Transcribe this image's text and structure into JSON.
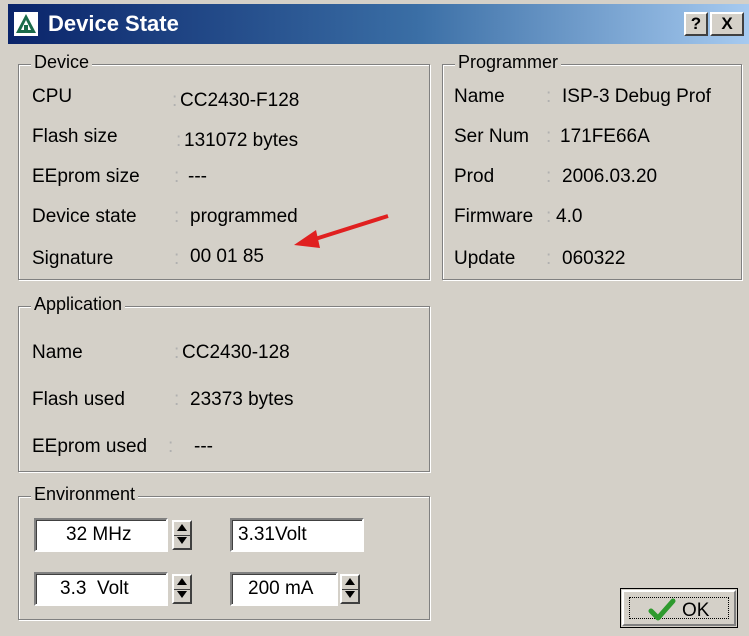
{
  "window": {
    "title": "Device State",
    "help_label": "?",
    "close_label": "X"
  },
  "device": {
    "legend": "Device",
    "rows": [
      {
        "label": "CPU",
        "value": "CC2430-F128"
      },
      {
        "label": "Flash size",
        "value": "131072 bytes"
      },
      {
        "label": "EEprom size",
        "value": "---"
      },
      {
        "label": "Device state",
        "value": "programmed"
      },
      {
        "label": "Signature",
        "value": "00 01 85"
      }
    ]
  },
  "programmer": {
    "legend": "Programmer",
    "rows": [
      {
        "label": "Name",
        "value": "ISP-3 Debug Prof"
      },
      {
        "label": "Ser Num",
        "value": "171FE66A"
      },
      {
        "label": "Prod",
        "value": "2006.03.20"
      },
      {
        "label": "Firmware",
        "value": "4.0"
      },
      {
        "label": "Update",
        "value": "060322"
      }
    ]
  },
  "application": {
    "legend": "Application",
    "rows": [
      {
        "label": "Name",
        "value": "CC2430-128"
      },
      {
        "label": "Flash used",
        "value": "23373 bytes"
      },
      {
        "label": "EEprom used",
        "value": "---"
      }
    ]
  },
  "environment": {
    "legend": "Environment",
    "clock": "32 MHz",
    "measured_voltage": "3.31Volt",
    "voltage": "3.3  Volt",
    "current": "200 mA"
  },
  "ok_label": "OK",
  "colors": {
    "annotation_arrow": "#e02020",
    "check": "#2e9a2e"
  }
}
